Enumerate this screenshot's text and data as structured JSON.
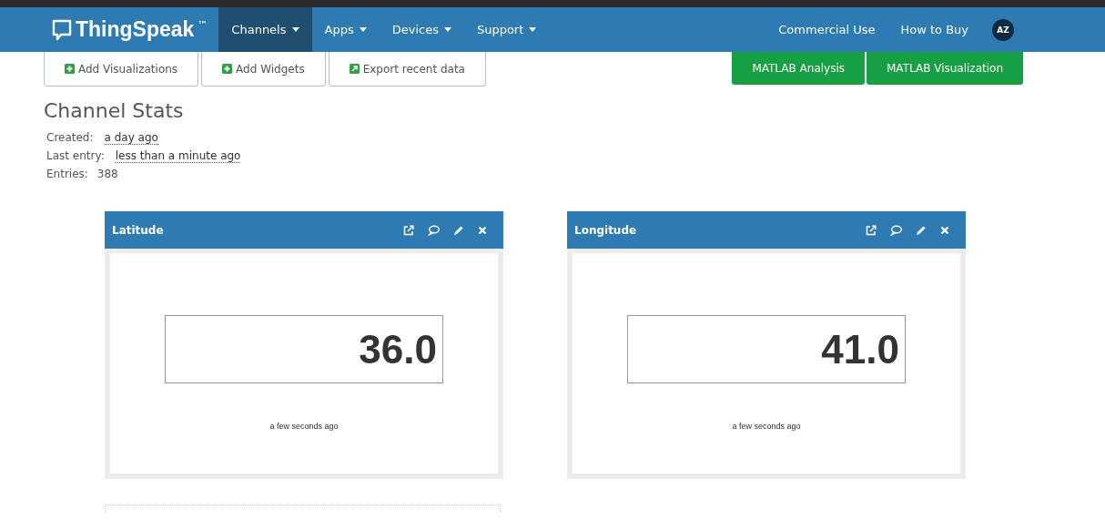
{
  "navbar": {
    "brand": "ThingSpeak",
    "trademark": "™",
    "menu": [
      {
        "label": "Channels",
        "selected": true
      },
      {
        "label": "Apps",
        "selected": false
      },
      {
        "label": "Devices",
        "selected": false
      },
      {
        "label": "Support",
        "selected": false
      }
    ],
    "links": [
      "Commercial Use",
      "How to Buy"
    ],
    "avatar": "AZ"
  },
  "toolbar": [
    {
      "label": "Add Visualizations",
      "kind": "add"
    },
    {
      "label": "Add Widgets",
      "kind": "add"
    },
    {
      "label": "Export recent data",
      "kind": "export"
    }
  ],
  "matlab_buttons": [
    "MATLAB Analysis",
    "MATLAB Visualization"
  ],
  "channel_stats": {
    "title": "Channel Stats",
    "items": [
      {
        "label": "Created:",
        "value": "a day ago",
        "kind": "time"
      },
      {
        "label": "Last entry:",
        "value": "less than a minute ago",
        "kind": "time"
      },
      {
        "label": "Entries:",
        "value": "388",
        "kind": "count"
      }
    ]
  },
  "widgets": [
    {
      "title": "Latitude",
      "value": "36.0",
      "updated": "a few seconds ago"
    },
    {
      "title": "Longitude",
      "value": "41.0",
      "updated": "a few seconds ago"
    }
  ]
}
